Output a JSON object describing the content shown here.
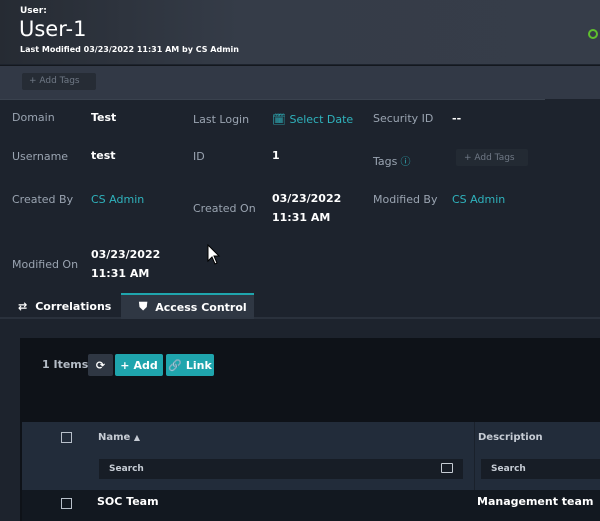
{
  "header": {
    "type_label": "User:",
    "title": "User-1",
    "last_modified": "Last Modified 03/23/2022 11:31 AM by CS Admin",
    "status_color": "#5fbf2e"
  },
  "tags_bar": {
    "add_tags": "+ Add Tags"
  },
  "details": {
    "domain": {
      "label": "Domain",
      "value": "Test"
    },
    "last_login": {
      "label": "Last Login",
      "value": "Select Date"
    },
    "security_id": {
      "label": "Security ID",
      "value": "--"
    },
    "username": {
      "label": "Username",
      "value": "test"
    },
    "id": {
      "label": "ID",
      "value": "1"
    },
    "tags": {
      "label": "Tags",
      "add": "+ Add Tags"
    },
    "created_by": {
      "label": "Created By",
      "value": "CS Admin"
    },
    "created_on": {
      "label": "Created On",
      "date": "03/23/2022",
      "time": "11:31 AM"
    },
    "modified_by": {
      "label": "Modified By",
      "value": "CS Admin"
    },
    "modified_on": {
      "label": "Modified On",
      "date": "03/23/2022",
      "time": "11:31 AM"
    }
  },
  "tabs": [
    {
      "label": "Correlations",
      "icon": "arrows-exchange-icon"
    },
    {
      "label": "Access Control",
      "icon": "shield-icon",
      "active": true
    }
  ],
  "toolbar": {
    "count": "1 Items",
    "add": "Add",
    "link": "Link"
  },
  "table": {
    "columns": [
      {
        "label": "Name",
        "sort": "ascending",
        "search_placeholder": "Search"
      },
      {
        "label": "Description",
        "search_placeholder": "Search"
      }
    ],
    "rows": [
      {
        "name": "SOC Team",
        "description": "Management team"
      }
    ]
  },
  "colors": {
    "accent": "#1fa5ad"
  }
}
